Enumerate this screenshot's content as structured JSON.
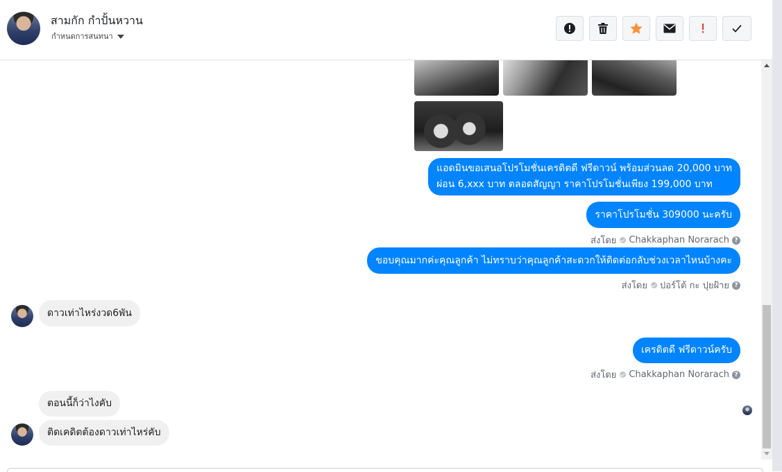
{
  "header": {
    "contact_name": "สามกัก กำปั้นหวาน",
    "assign_label": "กำหนดการสนทนา",
    "actions": [
      {
        "name": "spam-button",
        "icon": "alert-circle-icon"
      },
      {
        "name": "delete-button",
        "icon": "trash-icon"
      },
      {
        "name": "star-button",
        "icon": "star-icon",
        "color": "#f7923b"
      },
      {
        "name": "mark-unread-button",
        "icon": "envelope-icon"
      },
      {
        "name": "follow-up-button",
        "icon": "exclamation-icon",
        "color": "#e4433b"
      },
      {
        "name": "done-button",
        "icon": "check-icon"
      }
    ]
  },
  "messages": {
    "m1": "แอดมินขอเสนอโปรโมชั่นเครดิตดี ฟรีดาวน์ พร้อมส่วนลด 20,000 บาท",
    "m1b": "ผ่อน 6,xxx บาท ตลอดสัญญา ราคาโปรโมชั่นเพียง 199,000 บาท",
    "m2": "ราคาโปรโมชั่น 309000 นะครับ",
    "m2_sent_by_label": "ส่งโดย",
    "m2_sender": "Chakkaphan Norarach",
    "m3": "ขอบคุณมากค่ะคุณลูกค้า ไม่ทราบว่าคุณลูกค้าสะดวกให้ติดต่อกลับช่วงเวลาไหนบ้างคะ",
    "m3_sent_by_label": "ส่งโดย",
    "m3_sender": "ปอร์โต้ กะ ปุยฝ้าย",
    "m4": "ดาวเท่าไหร่งวด6พัน",
    "m5": "เครดิตดี ฟรีดาวน์ครับ",
    "m5_sent_by_label": "ส่งโดย",
    "m5_sender": "Chakkaphan Norarach",
    "m6": "ตอนนี้ก็ว่าไงคับ",
    "m7": "ติดเคดิตต้องดาวเท่าไหร่คับ"
  },
  "colors": {
    "outgoing_bubble": "#0084ff",
    "incoming_bubble": "#f1f0f0"
  }
}
